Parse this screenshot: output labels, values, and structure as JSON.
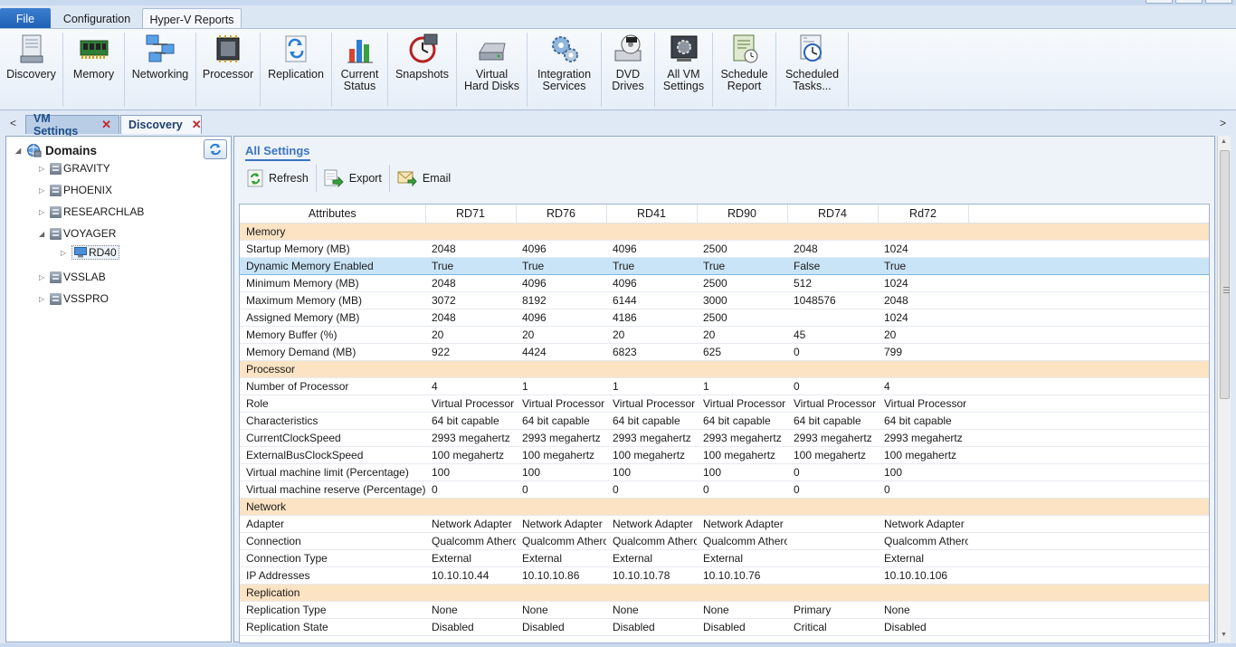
{
  "ribbon_tabs": {
    "file": "File",
    "configuration": "Configuration",
    "hyperv": "Hyper-V Reports"
  },
  "ribbon_buttons": [
    {
      "label": "Discovery",
      "icon": "discovery-icon"
    },
    {
      "label": "Memory",
      "icon": "memory-chip-icon"
    },
    {
      "label": "Networking",
      "icon": "networking-icon"
    },
    {
      "label": "Processor",
      "icon": "processor-icon"
    },
    {
      "label": "Replication",
      "icon": "replication-icon"
    },
    {
      "label": "Current\nStatus",
      "icon": "status-chart-icon"
    },
    {
      "label": "Snapshots",
      "icon": "snapshot-clock-icon"
    },
    {
      "label": "Virtual\nHard Disks",
      "icon": "hard-disk-icon"
    },
    {
      "label": "Integration\nServices",
      "icon": "gears-icon"
    },
    {
      "label": "DVD\nDrives",
      "icon": "dvd-drive-icon"
    },
    {
      "label": "All VM\nSettings",
      "icon": "vm-settings-icon"
    },
    {
      "label": "Schedule\nReport",
      "icon": "schedule-report-icon"
    },
    {
      "label": "Scheduled\nTasks...",
      "icon": "scheduled-tasks-icon"
    }
  ],
  "doc_tabs": [
    {
      "label": "VM Settings",
      "active": true
    },
    {
      "label": "Discovery",
      "active": false
    }
  ],
  "tree": {
    "root": "Domains",
    "nodes": [
      {
        "label": "GRAVITY"
      },
      {
        "label": "PHOENIX"
      },
      {
        "label": "RESEARCHLAB"
      },
      {
        "label": "VOYAGER",
        "expanded": true,
        "children": [
          {
            "label": "RD40"
          }
        ]
      },
      {
        "label": "VSSLAB"
      },
      {
        "label": "VSSPRO"
      }
    ]
  },
  "main": {
    "header": "All Settings",
    "toolbar": {
      "refresh": "Refresh",
      "export": "Export",
      "email": "Email"
    },
    "columns": [
      "Attributes",
      "RD71",
      "RD76",
      "RD41",
      "RD90",
      "RD74",
      "Rd72"
    ],
    "rows": [
      {
        "group": "Memory"
      },
      {
        "cells": [
          "Startup Memory (MB)",
          "2048",
          "4096",
          "4096",
          "2500",
          "2048",
          "1024"
        ]
      },
      {
        "cells": [
          "Dynamic Memory Enabled",
          "True",
          "True",
          "True",
          "True",
          "False",
          "True"
        ],
        "selected": true
      },
      {
        "cells": [
          "Minimum Memory (MB)",
          "2048",
          "4096",
          "4096",
          "2500",
          "512",
          "1024"
        ]
      },
      {
        "cells": [
          "Maximum Memory (MB)",
          "3072",
          "8192",
          "6144",
          "3000",
          "1048576",
          "2048"
        ]
      },
      {
        "cells": [
          "Assigned Memory (MB)",
          "2048",
          "4096",
          "4186",
          "2500",
          "",
          "1024"
        ]
      },
      {
        "cells": [
          "Memory Buffer (%)",
          "20",
          "20",
          "20",
          "20",
          "45",
          "20"
        ]
      },
      {
        "cells": [
          "Memory Demand (MB)",
          "922",
          "4424",
          "6823",
          "625",
          "0",
          "799"
        ]
      },
      {
        "group": "Processor"
      },
      {
        "cells": [
          "Number of Processor",
          "4",
          "1",
          "1",
          "1",
          "0",
          "4"
        ]
      },
      {
        "cells": [
          "Role",
          "Virtual Processor",
          "Virtual Processor",
          "Virtual Processor",
          "Virtual Processor",
          "Virtual Processor",
          "Virtual Processor"
        ]
      },
      {
        "cells": [
          "Characteristics",
          "64 bit capable",
          "64 bit capable",
          "64 bit capable",
          "64 bit capable",
          "64 bit capable",
          "64 bit capable"
        ]
      },
      {
        "cells": [
          "CurrentClockSpeed",
          "2993 megahertz",
          "2993 megahertz",
          "2993 megahertz",
          "2993 megahertz",
          "2993 megahertz",
          "2993 megahertz"
        ]
      },
      {
        "cells": [
          "ExternalBusClockSpeed",
          "100 megahertz",
          "100 megahertz",
          "100 megahertz",
          "100 megahertz",
          "100 megahertz",
          "100 megahertz"
        ]
      },
      {
        "cells": [
          "Virtual machine limit (Percentage)",
          "100",
          "100",
          "100",
          "100",
          "0",
          "100"
        ]
      },
      {
        "cells": [
          "Virtual machine reserve (Percentage)",
          "0",
          "0",
          "0",
          "0",
          "0",
          "0"
        ]
      },
      {
        "group": "Network"
      },
      {
        "cells": [
          "Adapter",
          "Network Adapter",
          "Network Adapter",
          "Network Adapter",
          "Network Adapter",
          "",
          "Network Adapter"
        ]
      },
      {
        "cells": [
          "Connection",
          "Qualcomm Atheros",
          "Qualcomm Atheros",
          "Qualcomm Atheros",
          "Qualcomm Atheros",
          "",
          "Qualcomm Atheros"
        ]
      },
      {
        "cells": [
          "Connection Type",
          "External",
          "External",
          "External",
          "External",
          "",
          "External"
        ]
      },
      {
        "cells": [
          "IP Addresses",
          "10.10.10.44",
          "10.10.10.86",
          "10.10.10.78",
          "10.10.10.76",
          "",
          "10.10.10.106"
        ]
      },
      {
        "group": "Replication"
      },
      {
        "cells": [
          "Replication Type",
          "None",
          "None",
          "None",
          "None",
          "Primary",
          "None"
        ]
      },
      {
        "cells": [
          "Replication State",
          "Disabled",
          "Disabled",
          "Disabled",
          "Disabled",
          "Critical",
          "Disabled"
        ]
      }
    ]
  },
  "colors": {
    "group_bg": "#fbe3c4",
    "selected_bg": "#c9e4f7",
    "accent": "#3b74c0"
  }
}
